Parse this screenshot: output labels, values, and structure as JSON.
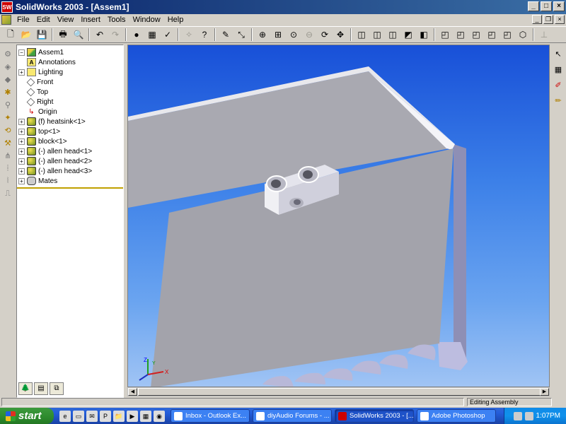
{
  "window": {
    "title": "SolidWorks 2003 - [Assem1]",
    "app_icon": "SW"
  },
  "menu": [
    "File",
    "Edit",
    "View",
    "Insert",
    "Tools",
    "Window",
    "Help"
  ],
  "tree": {
    "root": "Assem1",
    "items": [
      {
        "label": "Annotations",
        "icon": "annotations-icon",
        "expander": ""
      },
      {
        "label": "Lighting",
        "icon": "lighting-icon",
        "expander": "+"
      },
      {
        "label": "Front",
        "icon": "plane-icon",
        "expander": ""
      },
      {
        "label": "Top",
        "icon": "plane-icon",
        "expander": ""
      },
      {
        "label": "Right",
        "icon": "plane-icon",
        "expander": ""
      },
      {
        "label": "Origin",
        "icon": "origin-icon",
        "expander": ""
      },
      {
        "label": "(f) heatsink<1>",
        "icon": "part-icon",
        "expander": "+"
      },
      {
        "label": "top<1>",
        "icon": "part-icon",
        "expander": "+"
      },
      {
        "label": "block<1>",
        "icon": "part-icon",
        "expander": "+"
      },
      {
        "label": "(-) allen head<1>",
        "icon": "part-icon",
        "expander": "+"
      },
      {
        "label": "(-) allen head<2>",
        "icon": "part-icon",
        "expander": "+"
      },
      {
        "label": "(-) allen head<3>",
        "icon": "part-icon",
        "expander": "+"
      },
      {
        "label": "Mates",
        "icon": "mates-icon",
        "expander": "+"
      }
    ]
  },
  "triad": {
    "x": "X",
    "y": "Y",
    "z": "Z"
  },
  "status": {
    "mode": "Editing Assembly"
  },
  "taskbar": {
    "start": "start",
    "items": [
      {
        "label": "Inbox - Outlook Ex...",
        "active": false
      },
      {
        "label": "diyAudio Forums - ...",
        "active": false
      },
      {
        "label": "SolidWorks 2003 - [...",
        "active": true
      },
      {
        "label": "Adobe Photoshop",
        "active": false
      }
    ],
    "clock": "1:07PM"
  }
}
